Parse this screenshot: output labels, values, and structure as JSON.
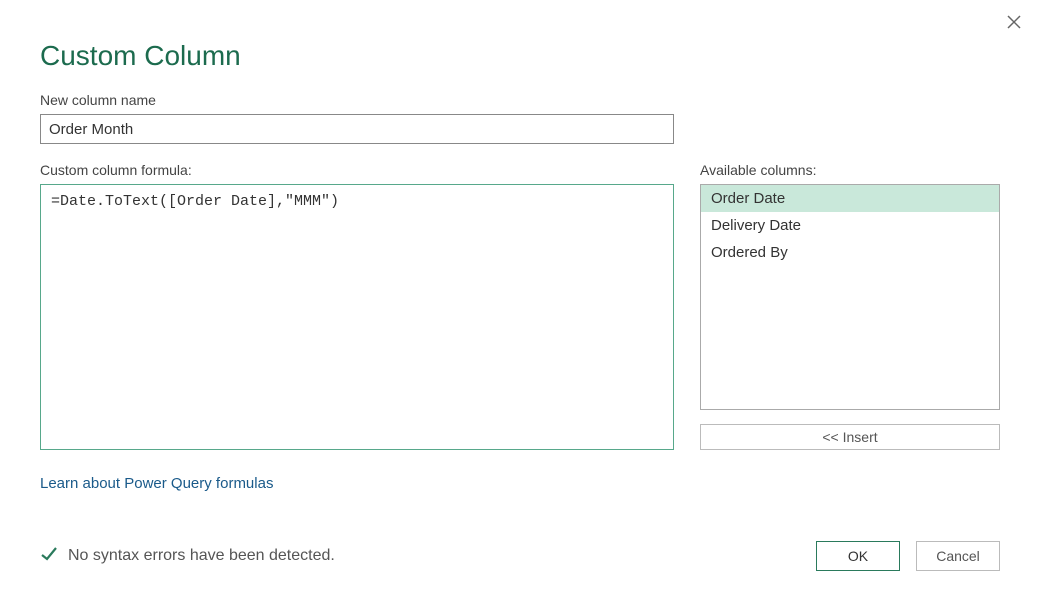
{
  "dialog": {
    "title": "Custom Column",
    "close_icon": "close",
    "new_column_label": "New column name",
    "new_column_value": "Order Month",
    "formula_label": "Custom column formula:",
    "formula_value": "=Date.ToText([Order Date],\"MMM\")",
    "available_label": "Available columns:",
    "available_columns": [
      "Order Date",
      "Delivery Date",
      "Ordered By"
    ],
    "insert_label": "<< Insert",
    "learn_link": "Learn about Power Query formulas",
    "status_text": "No syntax errors have been detected.",
    "ok_label": "OK",
    "cancel_label": "Cancel"
  }
}
